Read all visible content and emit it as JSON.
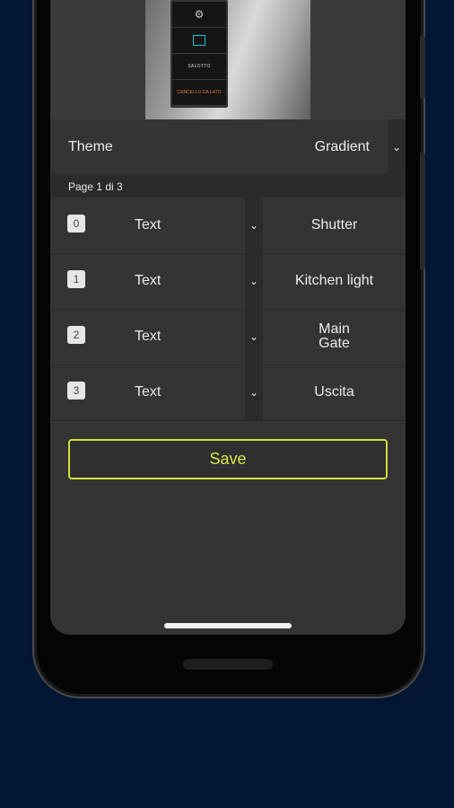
{
  "preview": {
    "row_labels": [
      "SALOTTO",
      "CANCELLO DA LATO"
    ]
  },
  "theme": {
    "label": "Theme",
    "value": "Gradient"
  },
  "page_indicator": "Page 1 di 3",
  "rows": [
    {
      "index": "0",
      "type": "Text",
      "name": "Shutter"
    },
    {
      "index": "1",
      "type": "Text",
      "name": "Kitchen light"
    },
    {
      "index": "2",
      "type": "Text",
      "name": "Main\nGate"
    },
    {
      "index": "3",
      "type": "Text",
      "name": "Uscita"
    }
  ],
  "save_label": "Save",
  "colors": {
    "accent": "#cfe03a",
    "background": "#021733",
    "panel": "#343434"
  },
  "icons": {
    "dropdown": "chevron-down-icon"
  }
}
